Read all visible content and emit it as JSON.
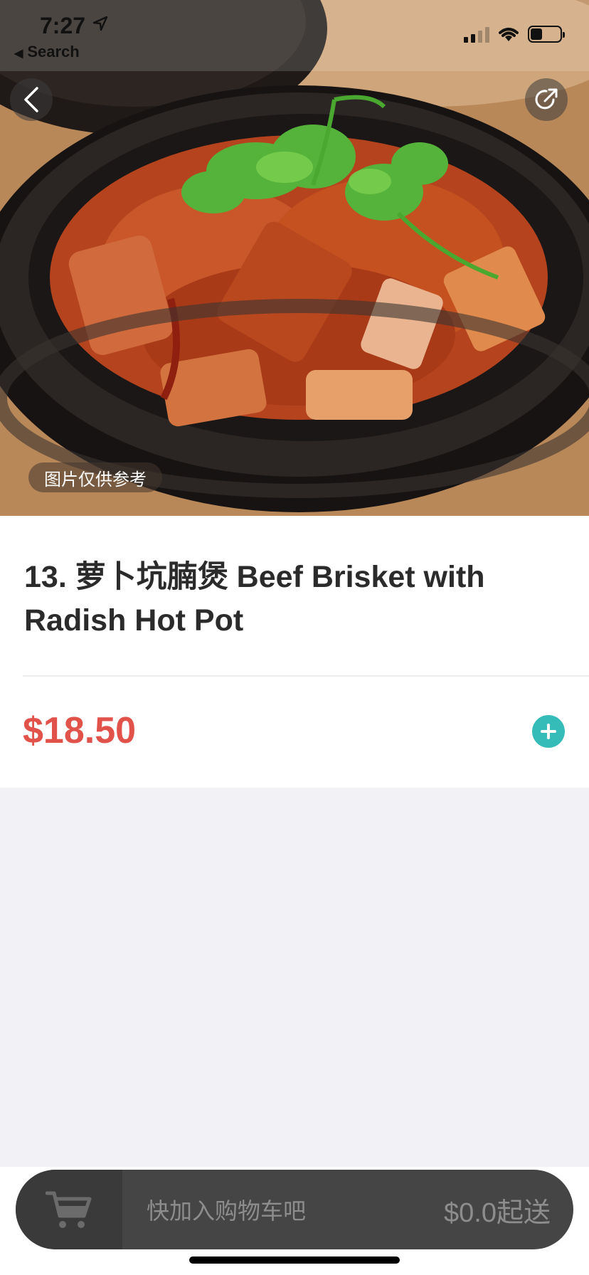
{
  "status_bar": {
    "time": "7:27",
    "back_app_label": "Search"
  },
  "hero": {
    "image_label": "图片仅供参考",
    "back_icon": "chevron-left-icon",
    "share_icon": "share-icon"
  },
  "item": {
    "title": "13. 萝卜坑腩煲 Beef Brisket with Radish Hot Pot",
    "price": "$18.50",
    "add_icon": "plus-icon",
    "accent_color": "#35bcb9",
    "price_color": "#e0524a"
  },
  "cart": {
    "icon": "cart-icon",
    "hint": "快加入购物车吧",
    "minimum": "$0.0起送"
  }
}
